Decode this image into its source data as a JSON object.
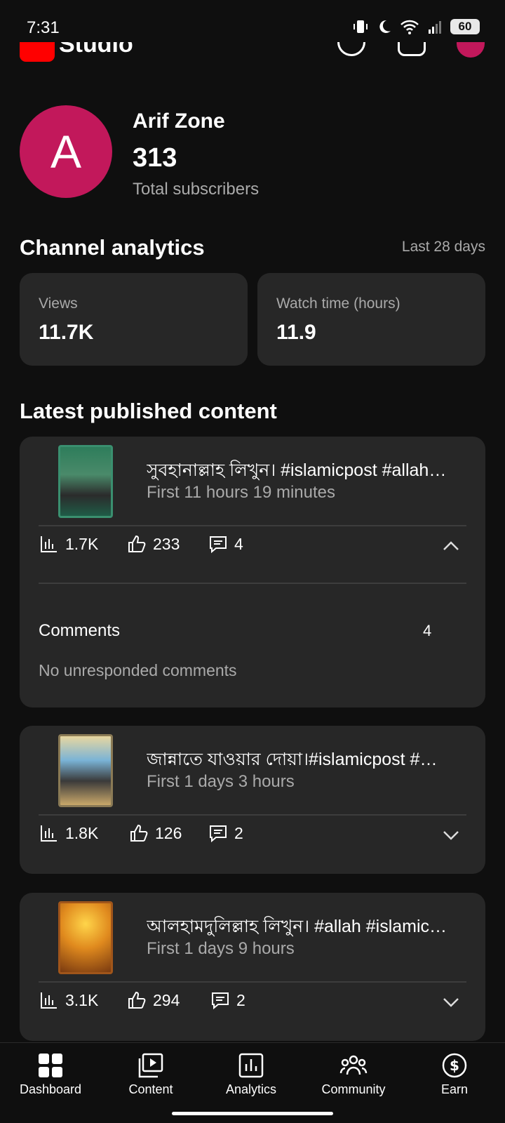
{
  "status_bar": {
    "time": "7:31",
    "battery": "60"
  },
  "app": {
    "logo_text": "Studio"
  },
  "channel": {
    "avatar_letter": "A",
    "name": "Arif Zone",
    "subscriber_count": "313",
    "subscriber_label": "Total subscribers"
  },
  "analytics": {
    "title": "Channel analytics",
    "period": "Last 28 days",
    "cards": [
      {
        "label": "Views",
        "value": "11.7K"
      },
      {
        "label": "Watch time (hours)",
        "value": "11.9"
      }
    ]
  },
  "latest": {
    "title": "Latest published content",
    "items": [
      {
        "title": "সুবহানাল্লাহ লিখুন। #islamicpost #allah…",
        "subtitle": "First 11 hours 19 minutes",
        "views": "1.7K",
        "likes": "233",
        "comments": "4",
        "expanded": true,
        "comments_label": "Comments",
        "comments_count": "4",
        "comments_status": "No unresponded comments"
      },
      {
        "title": "জান্নাতে যাওয়ার দোয়া।#islamicpost  #…",
        "subtitle": "First 1 days 3 hours",
        "views": "1.8K",
        "likes": "126",
        "comments": "2",
        "expanded": false
      },
      {
        "title": "আলহামদুলিল্লাহ লিখুন। #allah #islamic…",
        "subtitle": "First 1 days 9 hours",
        "views": "3.1K",
        "likes": "294",
        "comments": "2",
        "expanded": false
      }
    ]
  },
  "bottom_nav": [
    {
      "label": "Dashboard",
      "icon": "dashboard-icon"
    },
    {
      "label": "Content",
      "icon": "content-icon"
    },
    {
      "label": "Analytics",
      "icon": "analytics-icon"
    },
    {
      "label": "Community",
      "icon": "community-icon"
    },
    {
      "label": "Earn",
      "icon": "earn-icon"
    }
  ],
  "colors": {
    "accent_avatar": "#c2185b",
    "brand_red": "#ff0000",
    "background": "#0f0f0f",
    "card": "#272727"
  }
}
